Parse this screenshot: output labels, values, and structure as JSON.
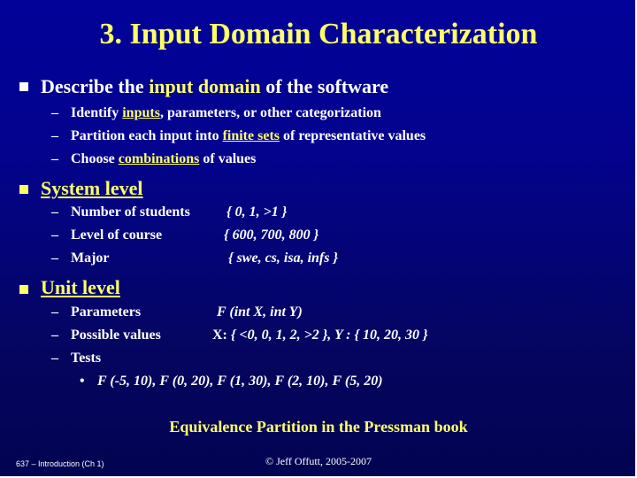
{
  "slide": {
    "title": "3. Input Domain Characterization",
    "section1": {
      "pre": "Describe the ",
      "highlight": "input domain",
      "post": " of the software",
      "items": [
        {
          "pre": "Identify ",
          "highlight": "inputs",
          "post": ", parameters, or other categorization"
        },
        {
          "pre": "Partition each input into ",
          "highlight": "finite sets",
          "post": " of representative values"
        },
        {
          "pre": "Choose ",
          "highlight": "combinations",
          "post": " of values"
        }
      ]
    },
    "section2": {
      "heading": "System level",
      "items": [
        {
          "label": "Number of students",
          "value": "{ 0, 1, >1 }"
        },
        {
          "label": "Level of course",
          "value": "{ 600, 700, 800 }"
        },
        {
          "label": "Major",
          "value": "{ swe, cs, isa, infs }"
        }
      ]
    },
    "section3": {
      "heading": "Unit level",
      "items": [
        {
          "label": "Parameters",
          "value": "F (int X, int Y)"
        },
        {
          "label": "Possible values",
          "value_prefix": "X: ",
          "value": "{ <0, 0, 1, 2, >2 }, Y : { 10, 20, 30 }"
        },
        {
          "label": "Tests",
          "value": ""
        }
      ],
      "tests": "F (-5, 10), F (0, 20), F (1, 30), F (2, 10), F (5, 20)"
    },
    "dash_glyph": "–",
    "dot_glyph": "•",
    "footer": {
      "note": "Equivalence Partition in the Pressman book",
      "course": "637 – Introduction (Ch 1)",
      "copyright": "© Jeff Offutt, 2005-2007"
    }
  }
}
